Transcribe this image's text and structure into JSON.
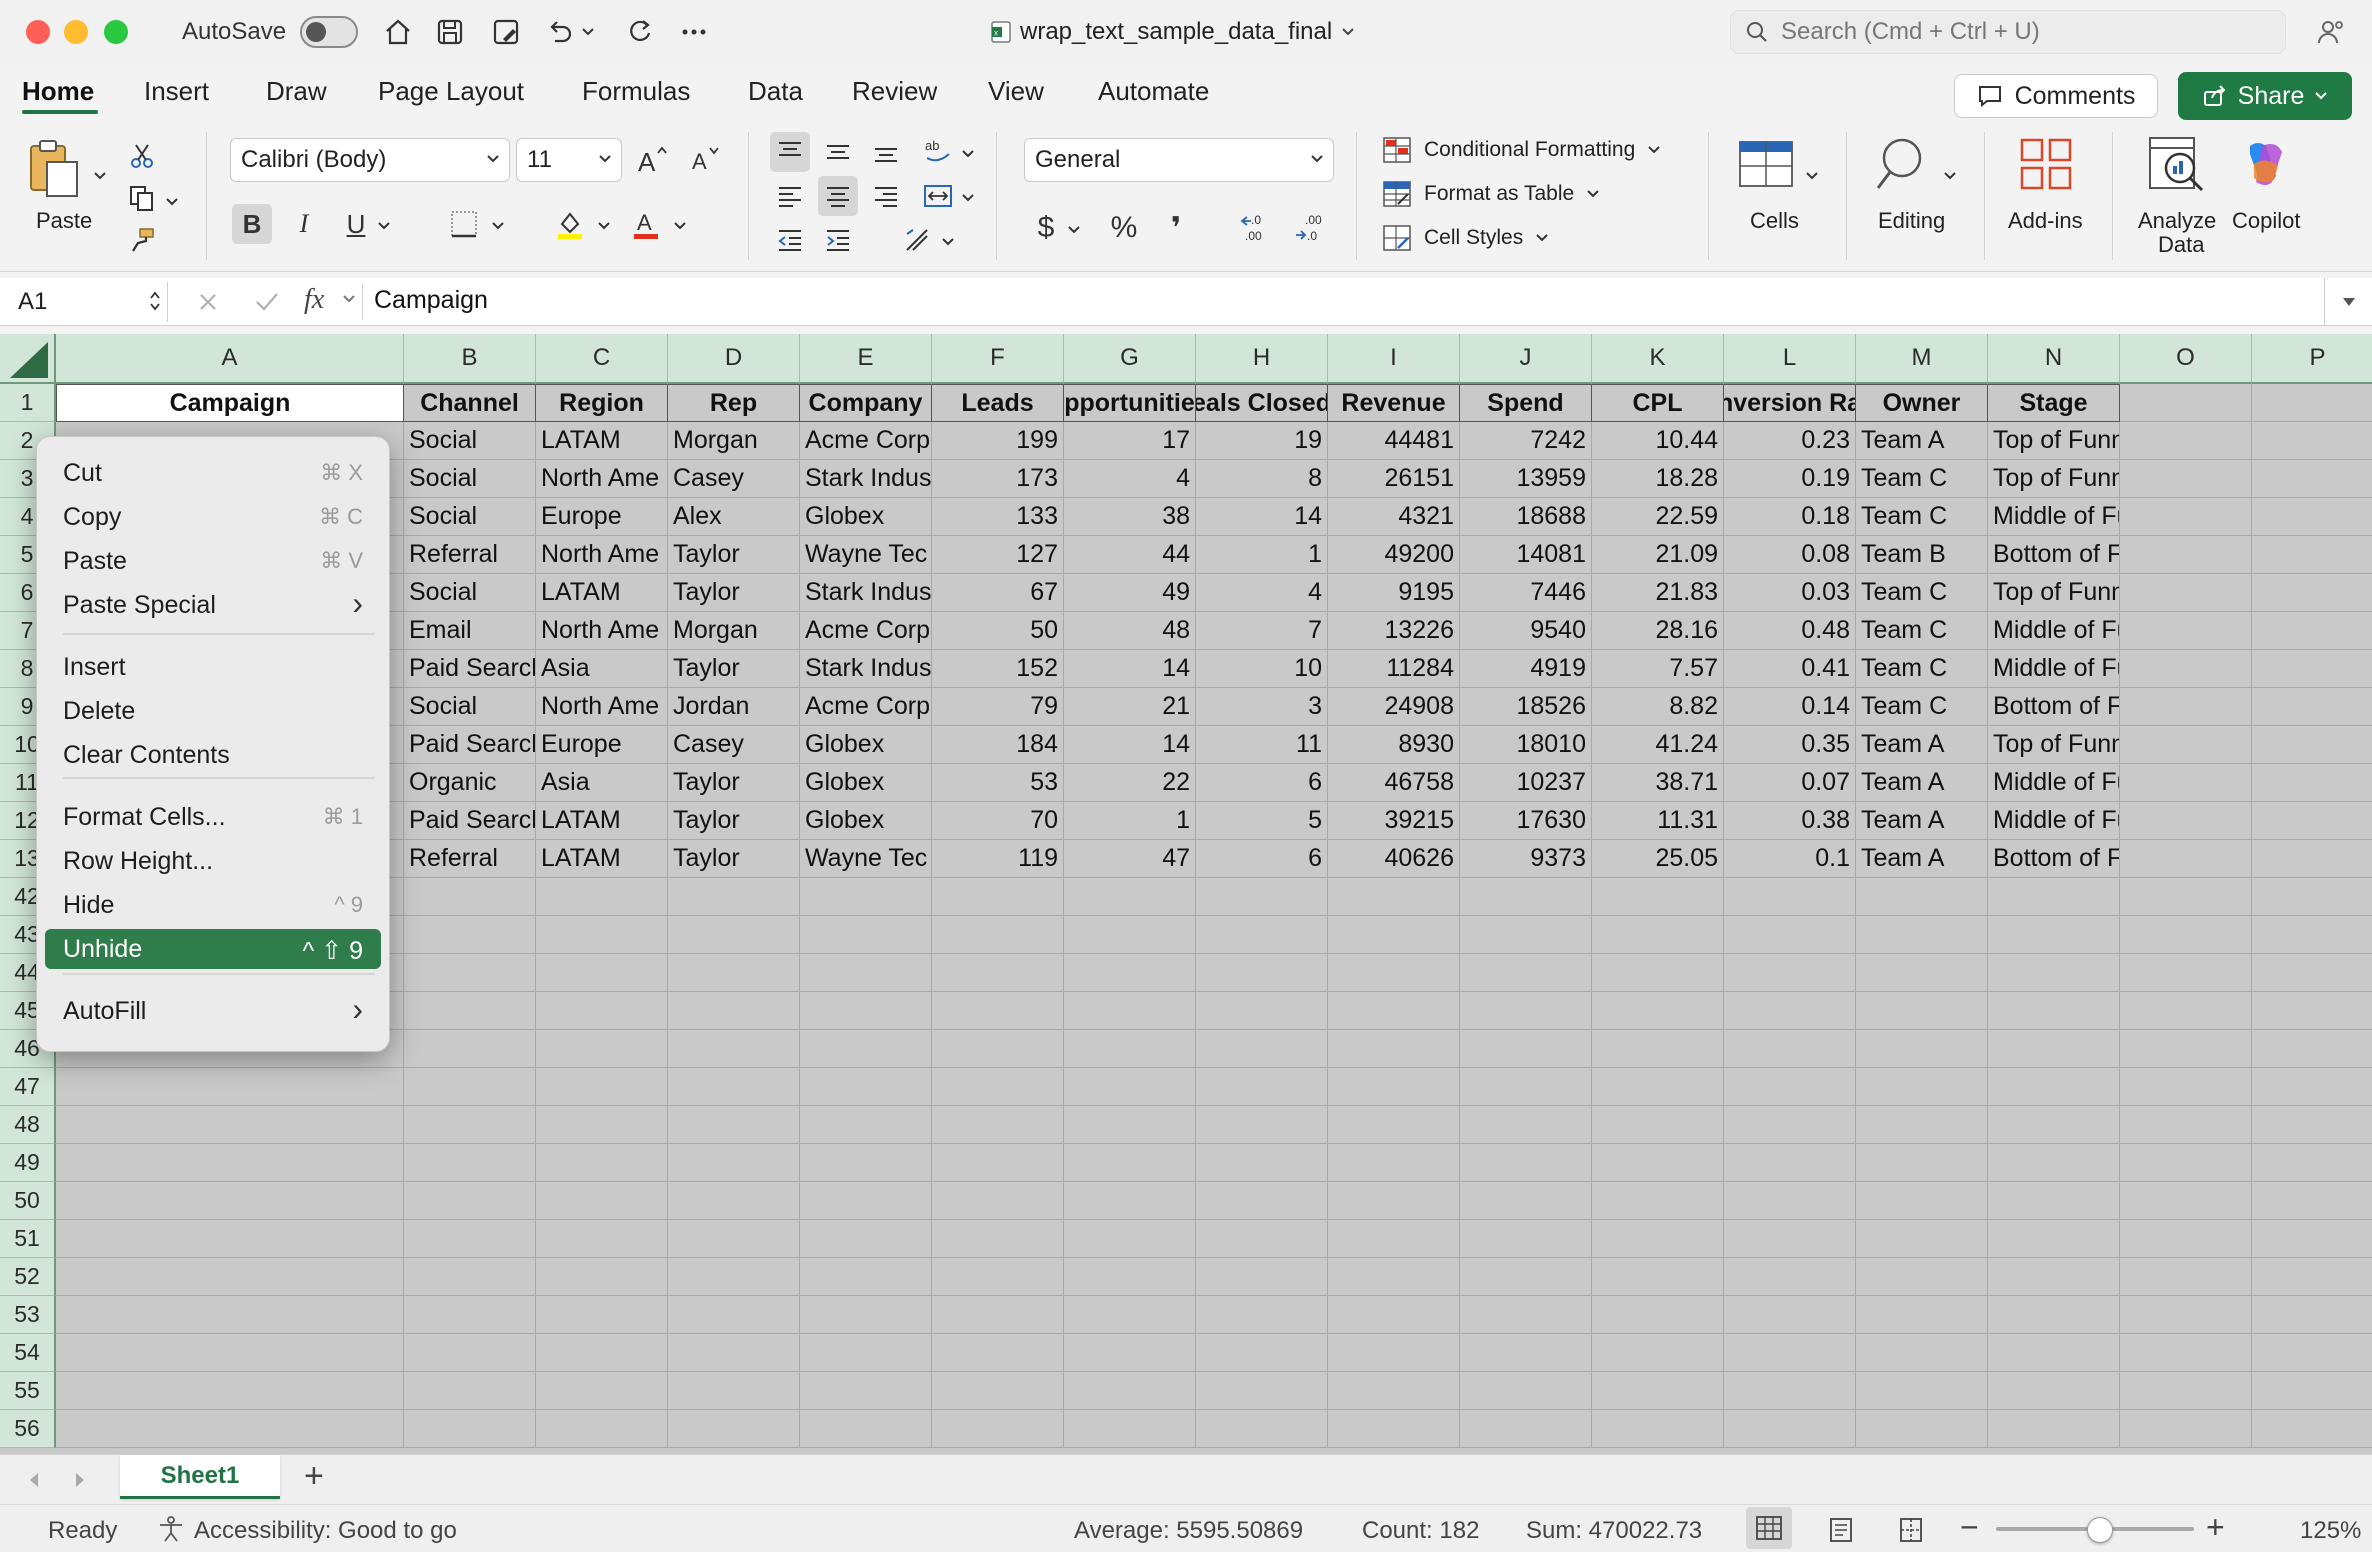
{
  "titlebar": {
    "autosave_label": "AutoSave",
    "doc_title": "wrap_text_sample_data_final",
    "search_placeholder": "Search (Cmd + Ctrl + U)"
  },
  "ribbon_tabs": [
    "Home",
    "Insert",
    "Draw",
    "Page Layout",
    "Formulas",
    "Data",
    "Review",
    "View",
    "Automate"
  ],
  "actions": {
    "comments": "Comments",
    "share": "Share"
  },
  "ribbon": {
    "paste_label": "Paste",
    "font_name": "Calibri (Body)",
    "font_size": "11",
    "bold": "B",
    "italic": "I",
    "underline": "U",
    "number_format": "General",
    "currency": "$",
    "percent": "%",
    "comma": "❜",
    "conditional_formatting": "Conditional Formatting",
    "format_as_table": "Format as Table",
    "cell_styles": "Cell Styles",
    "cells_label": "Cells",
    "editing_label": "Editing",
    "addins_label": "Add-ins",
    "analyze_label_1": "Analyze",
    "analyze_label_2": "Data",
    "copilot_label": "Copilot"
  },
  "formula_bar": {
    "name_box": "A1",
    "fx": "fx",
    "content": "Campaign"
  },
  "columns": [
    "A",
    "B",
    "C",
    "D",
    "E",
    "F",
    "G",
    "H",
    "I",
    "J",
    "K",
    "L",
    "M",
    "N",
    "O",
    "P"
  ],
  "row_numbers": [
    "1",
    "2",
    "3",
    "4",
    "5",
    "6",
    "7",
    "8",
    "9",
    "10",
    "11",
    "12",
    "13",
    "42",
    "43",
    "44",
    "45",
    "46",
    "47",
    "48",
    "49",
    "50",
    "51",
    "52",
    "53",
    "54",
    "55",
    "56"
  ],
  "headers": [
    "Campaign",
    "Channel",
    "Region",
    "Rep",
    "Company",
    "Leads",
    "pportunitie",
    "eals Closed",
    "Revenue",
    "Spend",
    "CPL",
    "nversion Ra",
    "Owner",
    "Stage"
  ],
  "rows": [
    [
      "",
      "Social",
      "LATAM",
      "Morgan",
      "Acme Corp",
      "199",
      "17",
      "19",
      "44481",
      "7242",
      "10.44",
      "0.23",
      "Team A",
      "Top of Funnel"
    ],
    [
      "",
      "Social",
      "North Ame",
      "Casey",
      "Stark Indus",
      "173",
      "4",
      "8",
      "26151",
      "13959",
      "18.28",
      "0.19",
      "Team C",
      "Top of Funnel"
    ],
    [
      "",
      "Social",
      "Europe",
      "Alex",
      "Globex",
      "133",
      "38",
      "14",
      "4321",
      "18688",
      "22.59",
      "0.18",
      "Team C",
      "Middle of Funnel"
    ],
    [
      "",
      "Referral",
      "North Ame",
      "Taylor",
      "Wayne Tec",
      "127",
      "44",
      "1",
      "49200",
      "14081",
      "21.09",
      "0.08",
      "Team B",
      "Bottom of Funnel"
    ],
    [
      "",
      "Social",
      "LATAM",
      "Taylor",
      "Stark Indus",
      "67",
      "49",
      "4",
      "9195",
      "7446",
      "21.83",
      "0.03",
      "Team C",
      "Top of Funnel"
    ],
    [
      "",
      "Email",
      "North Ame",
      "Morgan",
      "Acme Corp",
      "50",
      "48",
      "7",
      "13226",
      "9540",
      "28.16",
      "0.48",
      "Team C",
      "Middle of Funnel"
    ],
    [
      "",
      "Paid Search",
      "Asia",
      "Taylor",
      "Stark Indus",
      "152",
      "14",
      "10",
      "11284",
      "4919",
      "7.57",
      "0.41",
      "Team C",
      "Middle of Funnel"
    ],
    [
      "",
      "Social",
      "North Ame",
      "Jordan",
      "Acme Corp",
      "79",
      "21",
      "3",
      "24908",
      "18526",
      "8.82",
      "0.14",
      "Team C",
      "Bottom of Funnel"
    ],
    [
      "",
      "Paid Search",
      "Europe",
      "Casey",
      "Globex",
      "184",
      "14",
      "11",
      "8930",
      "18010",
      "41.24",
      "0.35",
      "Team A",
      "Top of Funnel"
    ],
    [
      "",
      "Organic",
      "Asia",
      "Taylor",
      "Globex",
      "53",
      "22",
      "6",
      "46758",
      "10237",
      "38.71",
      "0.07",
      "Team A",
      "Middle of Funnel"
    ],
    [
      "",
      "Paid Search",
      "LATAM",
      "Taylor",
      "Globex",
      "70",
      "1",
      "5",
      "39215",
      "17630",
      "11.31",
      "0.38",
      "Team A",
      "Middle of Funnel"
    ],
    [
      "",
      "Referral",
      "LATAM",
      "Taylor",
      "Wayne Tec",
      "119",
      "47",
      "6",
      "40626",
      "9373",
      "25.05",
      "0.1",
      "Team A",
      "Bottom of Funnel"
    ]
  ],
  "context_menu": {
    "items": [
      {
        "label": "Cut",
        "shortcut": "⌘ X"
      },
      {
        "label": "Copy",
        "shortcut": "⌘ C"
      },
      {
        "label": "Paste",
        "shortcut": "⌘ V"
      },
      {
        "label": "Paste Special",
        "shortcut": "›"
      },
      {
        "label": "Insert",
        "shortcut": ""
      },
      {
        "label": "Delete",
        "shortcut": ""
      },
      {
        "label": "Clear Contents",
        "shortcut": ""
      },
      {
        "label": "Format Cells...",
        "shortcut": "⌘ 1"
      },
      {
        "label": "Row Height...",
        "shortcut": ""
      },
      {
        "label": "Hide",
        "shortcut": "^ 9"
      },
      {
        "label": "Unhide",
        "shortcut": "^ ⇧ 9"
      },
      {
        "label": "AutoFill",
        "shortcut": "›"
      }
    ],
    "highlighted": "Unhide"
  },
  "sheets": {
    "active": "Sheet1",
    "add": "+"
  },
  "status": {
    "ready": "Ready",
    "accessibility": "Accessibility: Good to go",
    "average": "Average: 5595.50869",
    "count": "Count: 182",
    "sum": "Sum: 470022.73",
    "zoom": "125%",
    "zoom_minus": "−",
    "zoom_plus": "+"
  },
  "colors": {
    "accent": "#217346",
    "share": "#1f7a44",
    "header_bg": "#d1e6d8",
    "menu_highlight": "#2f7d4a"
  }
}
